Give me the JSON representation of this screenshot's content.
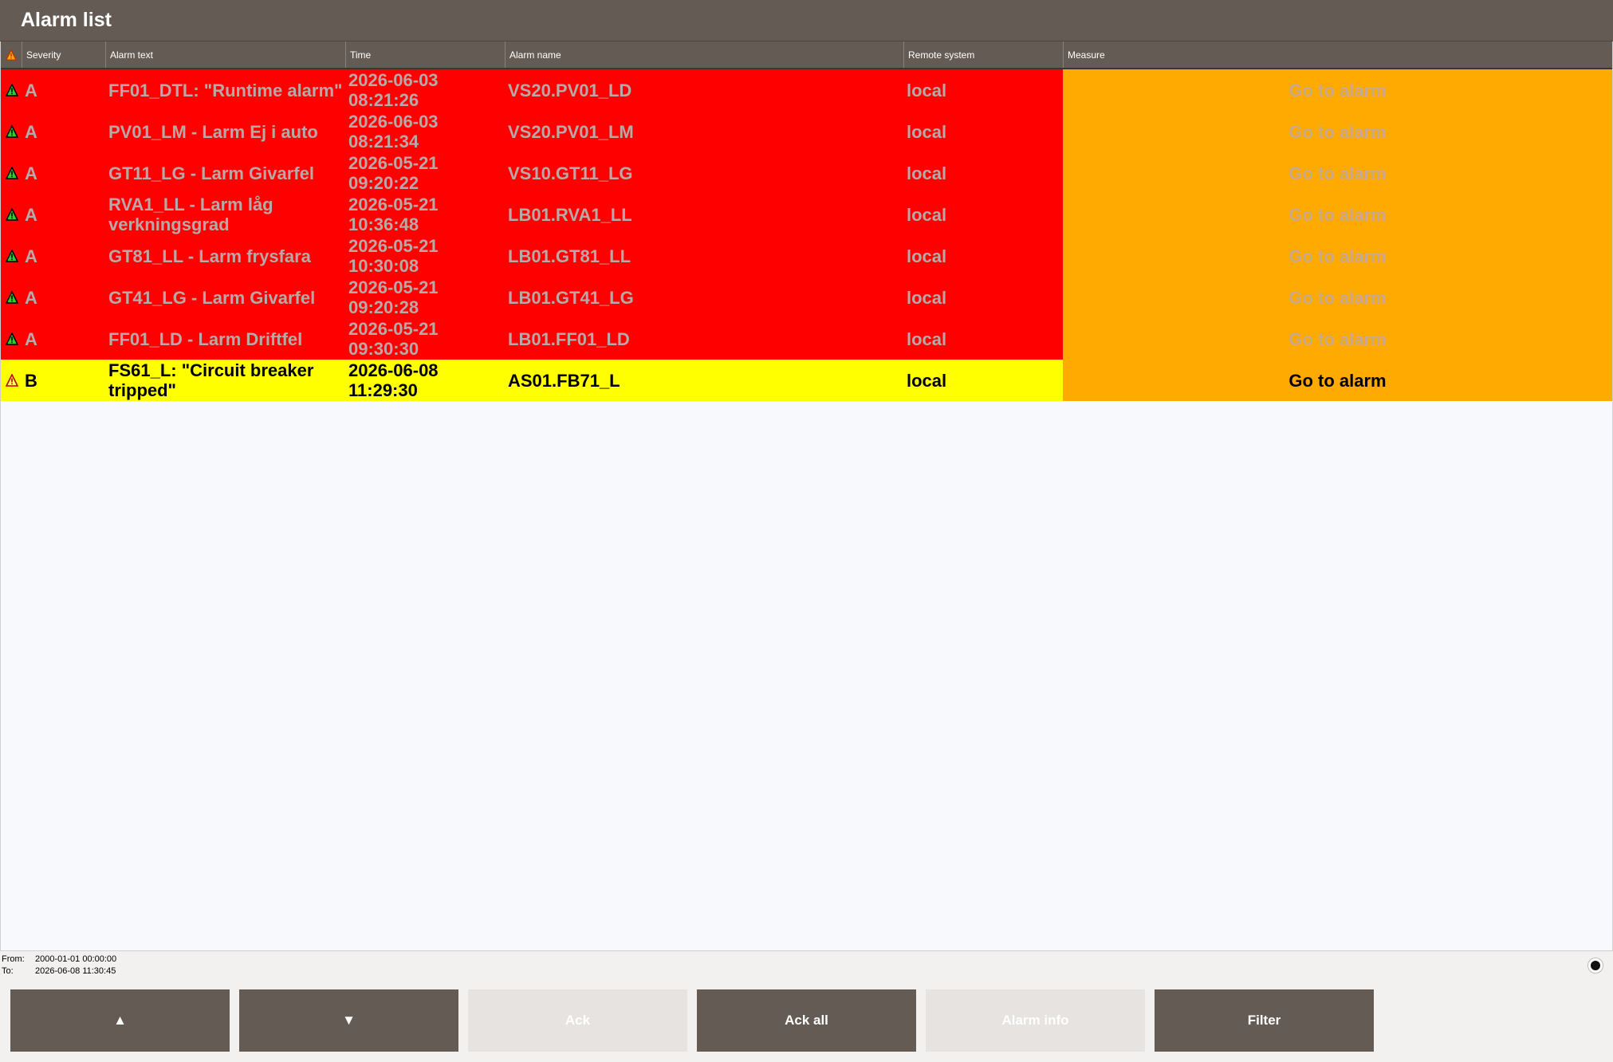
{
  "window": {
    "title": "Alarm list"
  },
  "table": {
    "columns": [
      "",
      "Severity",
      "Alarm text",
      "Time",
      "Alarm name",
      "Remote system",
      "Measure"
    ],
    "rows": [
      {
        "state": "red",
        "severity": "A",
        "text": "FF01_DTL: \"Runtime alarm\"",
        "time": "2026-06-03 08:21:26",
        "name": "VS20.PV01_LD",
        "remote": "local",
        "measure": "Go to alarm"
      },
      {
        "state": "red",
        "severity": "A",
        "text": "PV01_LM - Larm Ej i auto",
        "time": "2026-06-03 08:21:34",
        "name": "VS20.PV01_LM",
        "remote": "local",
        "measure": "Go to alarm"
      },
      {
        "state": "red",
        "severity": "A",
        "text": "GT11_LG - Larm Givarfel",
        "time": "2026-05-21 09:20:22",
        "name": "VS10.GT11_LG",
        "remote": "local",
        "measure": "Go to alarm"
      },
      {
        "state": "red",
        "severity": "A",
        "text": "RVA1_LL - Larm låg verkningsgrad",
        "time": "2026-05-21 10:36:48",
        "name": "LB01.RVA1_LL",
        "remote": "local",
        "measure": "Go to alarm"
      },
      {
        "state": "red",
        "severity": "A",
        "text": "GT81_LL - Larm frysfara",
        "time": "2026-05-21 10:30:08",
        "name": "LB01.GT81_LL",
        "remote": "local",
        "measure": "Go to alarm"
      },
      {
        "state": "red",
        "severity": "A",
        "text": "GT41_LG - Larm Givarfel",
        "time": "2026-05-21 09:20:28",
        "name": "LB01.GT41_LG",
        "remote": "local",
        "measure": "Go to alarm"
      },
      {
        "state": "red",
        "severity": "A",
        "text": "FF01_LD - Larm Driftfel",
        "time": "2026-05-21 09:30:30",
        "name": "LB01.FF01_LD",
        "remote": "local",
        "measure": "Go to alarm"
      },
      {
        "state": "yellow",
        "severity": "B",
        "text": "FS61_L: \"Circuit breaker tripped\"",
        "time": "2026-06-08 11:29:30",
        "name": "AS01.FB71_L",
        "remote": "local",
        "measure": "Go to alarm"
      }
    ]
  },
  "filter_range": {
    "from_label": "From:",
    "from_value": "2000-01-01 00:00:00",
    "to_label": "To:",
    "to_value": "2026-06-08 11:30:45"
  },
  "buttons": [
    {
      "id": "up",
      "label": "▲",
      "enabled": true
    },
    {
      "id": "down",
      "label": "▼",
      "enabled": true
    },
    {
      "id": "ack",
      "label": "Ack",
      "enabled": false
    },
    {
      "id": "ack_all",
      "label": "Ack all",
      "enabled": true
    },
    {
      "id": "alarm_info",
      "label": "Alarm info",
      "enabled": false
    },
    {
      "id": "filter",
      "label": "Filter",
      "enabled": true
    }
  ],
  "colors": {
    "accent": "#645b55",
    "alarm_red": "#ff0000",
    "alarm_yellow": "#ffff00",
    "measure_orange": "#ffaa00"
  },
  "icons": {
    "row_icon": "warning-triangle-icon",
    "header_icon": "warning-triangle-icon"
  }
}
